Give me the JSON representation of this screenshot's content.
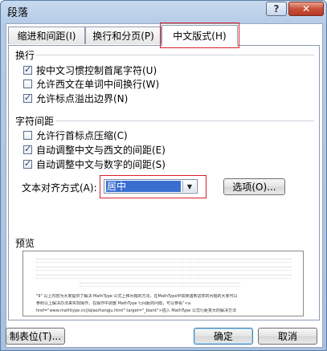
{
  "window": {
    "title": "段落"
  },
  "titlebar": {
    "help_glyph": "?",
    "close_glyph": "✕"
  },
  "tabs": [
    {
      "label": "缩进和间距(I)"
    },
    {
      "label": "换行和分页(P)"
    },
    {
      "label": "中文版式(H)"
    }
  ],
  "wrap_group": {
    "title": "换行",
    "options": [
      {
        "label": "按中文习惯控制首尾字符(U)",
        "checked": true
      },
      {
        "label": "允许西文在单词中间换行(W)",
        "checked": false
      },
      {
        "label": "允许标点溢出边界(N)",
        "checked": true
      }
    ]
  },
  "spacing_group": {
    "title": "字符间距",
    "options": [
      {
        "label": "允许行首标点压缩(C)",
        "checked": false
      },
      {
        "label": "自动调整中文与西文的间距(E)",
        "checked": true
      },
      {
        "label": "自动调整中文与数字的间距(S)",
        "checked": true
      }
    ]
  },
  "alignment": {
    "label": "文本对齐方式(A):",
    "value": "居中",
    "options_button": "选项(O)..."
  },
  "preview": {
    "label": "预览",
    "text_lines": [
      "\"9\" 以上内容为大家提供了解决 MathType 公式上移问题的方法，在MathType中如果遇到这样的问题的大家可以",
      "参照以上解决办法来实现操作，在操作中调整 MathType 行间距的问题，可以参看“<a",
      "href=\"www.mathtype.cn/jiqiao/hangju.html\" target=\"_blank\">插入 MathType 公式行距变大的解决方法"
    ]
  },
  "footer": {
    "tab_stops_button": "制表位(T)...",
    "ok_button": "确定",
    "cancel_button": "取消"
  }
}
